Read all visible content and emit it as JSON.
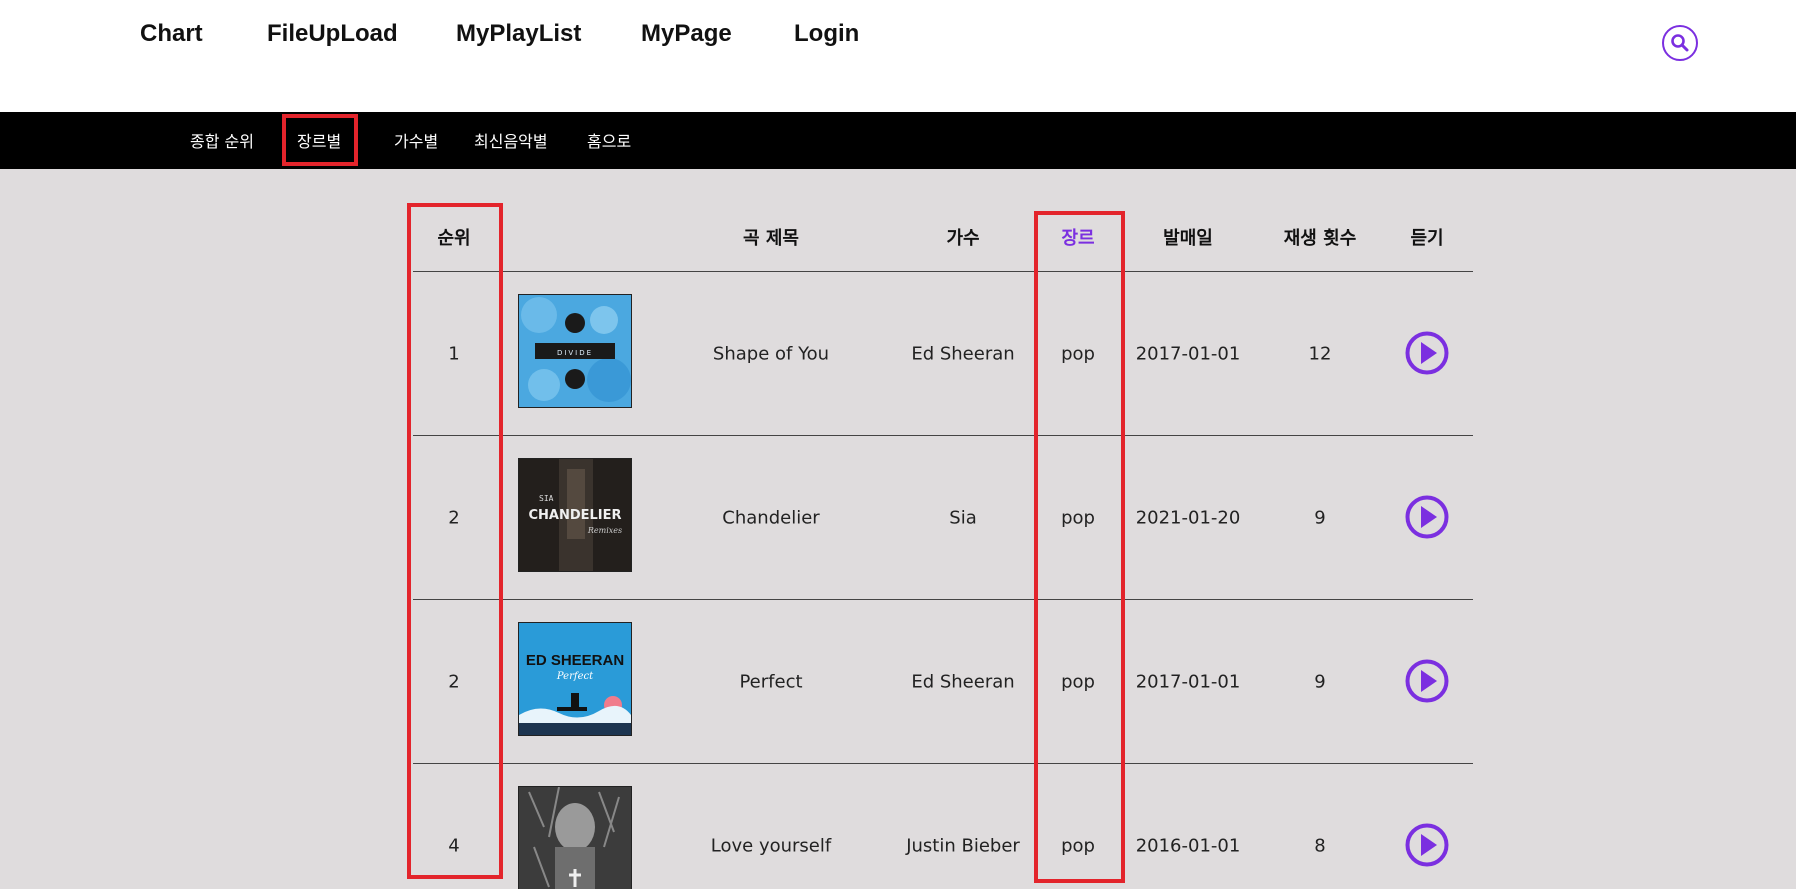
{
  "topnav": {
    "items": [
      "Chart",
      "FileUpLoad",
      "MyPlayList",
      "MyPage",
      "Login"
    ]
  },
  "subnav": {
    "items": [
      "종합 순위",
      "장르별",
      "가수별",
      "최신음악별",
      "홈으로"
    ],
    "active_index": 1
  },
  "table": {
    "headers": [
      "순위",
      "곡 제목",
      "가수",
      "장르",
      "발매일",
      "재생 횟수",
      "듣기"
    ],
    "active_header": "장르",
    "rows": [
      {
        "rank": "1",
        "title": "Shape of You",
        "artist": "Ed Sheeran",
        "genre": "pop",
        "release": "2017-01-01",
        "plays": "12",
        "cover": "divide-album-cover"
      },
      {
        "rank": "2",
        "title": "Chandelier",
        "artist": "Sia",
        "genre": "pop",
        "release": "2021-01-20",
        "plays": "9",
        "cover": "chandelier-single-cover"
      },
      {
        "rank": "2",
        "title": "Perfect",
        "artist": "Ed Sheeran",
        "genre": "pop",
        "release": "2017-01-01",
        "plays": "9",
        "cover": "perfect-single-cover"
      },
      {
        "rank": "4",
        "title": "Love yourself",
        "artist": "Justin Bieber",
        "genre": "pop",
        "release": "2016-01-01",
        "plays": "8",
        "cover": "purpose-album-cover"
      }
    ]
  },
  "cover_text": {
    "divide": "DIVIDE",
    "chandelier_artist": "SIA",
    "chandelier_title": "CHANDELIER",
    "chandelier_sub": "Remixes",
    "perfect_artist": "ED SHEERAN",
    "perfect_title": "Perfect"
  },
  "colors": {
    "accent": "#7b2fe0",
    "highlight": "#e3242b",
    "background": "#dfdcdd",
    "subbar": "#000000"
  },
  "icons": {
    "search": "search-icon",
    "play": "play-icon"
  }
}
